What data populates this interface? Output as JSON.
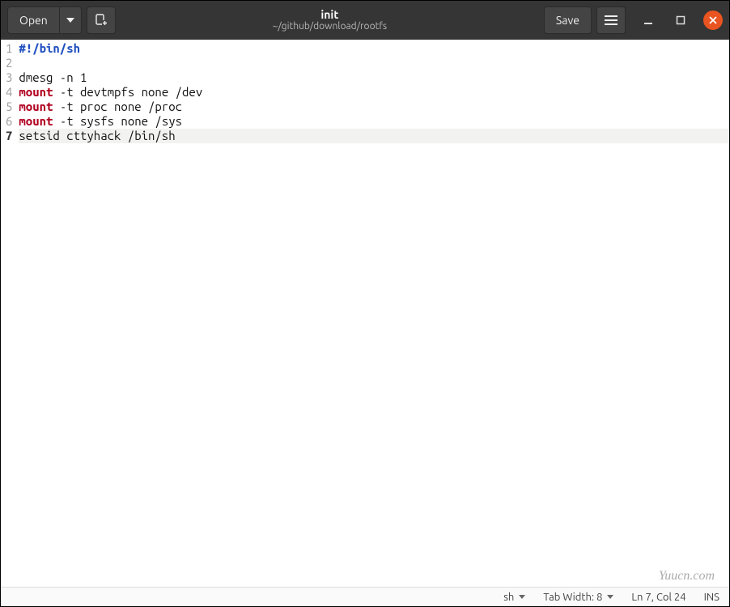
{
  "titlebar": {
    "open_label": "Open",
    "save_label": "Save",
    "title": "init",
    "subtitle": "~/github/download/rootfs"
  },
  "code": {
    "lines": [
      {
        "n": 1,
        "pre": "",
        "kw": "#!/bin/sh",
        "kw_class": "kw-blue",
        "rest": ""
      },
      {
        "n": 2,
        "pre": "",
        "kw": "",
        "kw_class": "",
        "rest": ""
      },
      {
        "n": 3,
        "pre": "dmesg -n 1",
        "kw": "",
        "kw_class": "",
        "rest": ""
      },
      {
        "n": 4,
        "pre": "",
        "kw": "mount",
        "kw_class": "kw-red",
        "rest": " -t devtmpfs none /dev"
      },
      {
        "n": 5,
        "pre": "",
        "kw": "mount",
        "kw_class": "kw-red",
        "rest": " -t proc none /proc"
      },
      {
        "n": 6,
        "pre": "",
        "kw": "mount",
        "kw_class": "kw-red",
        "rest": " -t sysfs none /sys"
      },
      {
        "n": 7,
        "pre": "setsid cttyhack /bin/sh",
        "kw": "",
        "kw_class": "",
        "rest": ""
      }
    ],
    "current_line": 7
  },
  "statusbar": {
    "language": "sh",
    "tab_width_label": "Tab Width: 8",
    "position": "Ln 7, Col 24",
    "insert_mode": "INS"
  },
  "watermark": "Yuucn.com"
}
